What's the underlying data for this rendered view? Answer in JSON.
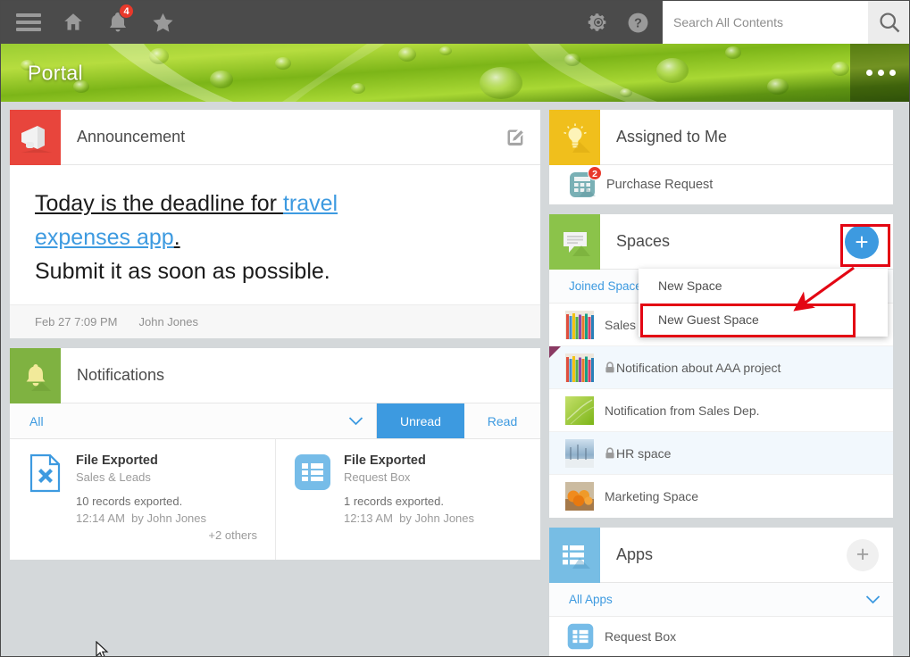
{
  "topbar": {
    "menu_icon": "hamburger-icon",
    "home_icon": "home-icon",
    "bell_icon": "bell-icon",
    "bell_badge": "4",
    "star_icon": "star-icon",
    "gear_icon": "gear-icon",
    "help_icon": "help-icon",
    "search_placeholder": "Search All Contents",
    "search_value": "",
    "search_icon": "magnifier-icon"
  },
  "banner": {
    "title": "Portal",
    "more_icon": "ellipsis-icon"
  },
  "announcement": {
    "icon": "megaphone-icon",
    "title": "Announcement",
    "edit_icon": "edit-pencil-icon",
    "line1_a": "Today is the deadline for ",
    "line1_link": "travel",
    "line2_link": "expenses app",
    "line2_period": ".",
    "line3": "Submit it as soon as possible.",
    "date": "Feb 27 7:09 PM",
    "author": "John Jones",
    "accent": "#e8453c"
  },
  "notifications": {
    "icon": "bell-icon",
    "title": "Notifications",
    "filter_all": "All",
    "filter_chevron": "chevron-down-icon",
    "tab_unread": "Unread",
    "tab_read": "Read",
    "accent": "#3d9ae0",
    "header_color": "#7fb241",
    "items": [
      {
        "icon": "file-export-icon",
        "title": "File Exported",
        "source": "Sales & Leads",
        "message": "10 records exported.",
        "time": "12:14 AM",
        "by": "by John Jones",
        "more": "+2 others"
      },
      {
        "icon": "list-app-icon",
        "title": "File Exported",
        "source": "Request Box",
        "message": "1 records exported.",
        "time": "12:13 AM",
        "by": "by John Jones",
        "more": ""
      }
    ]
  },
  "assigned": {
    "icon": "lightbulb-icon",
    "title": "Assigned to Me",
    "header_color": "#f0bf1c",
    "items": [
      {
        "icon": "calculator-icon",
        "label": "Purchase Request",
        "badge": "2"
      }
    ]
  },
  "spaces": {
    "icon": "speech-bubble-icon",
    "title": "Spaces",
    "header_color": "#8bc34a",
    "add_icon": "plus-circle-icon",
    "filter": "Joined Spaces",
    "filter_chevron": "chevron-down-icon",
    "items": [
      {
        "thumb": "pencils",
        "name": "Sales",
        "locked": false,
        "alt": false,
        "marked": false
      },
      {
        "thumb": "pencils",
        "name": "Notification about AAA project",
        "locked": true,
        "alt": true,
        "marked": true
      },
      {
        "thumb": "greenleaf",
        "name": "Notification from Sales Dep.",
        "locked": false,
        "alt": false,
        "marked": false
      },
      {
        "thumb": "winter",
        "name": "HR space",
        "locked": true,
        "alt": true,
        "marked": false
      },
      {
        "thumb": "oranges",
        "name": "Marketing Space",
        "locked": false,
        "alt": false,
        "marked": false
      }
    ]
  },
  "spaces_menu": {
    "items": [
      "New Space",
      "New Guest Space"
    ],
    "highlighted": "New Guest Space"
  },
  "apps": {
    "icon": "list-app-icon",
    "title": "Apps",
    "header_color": "#77bde4",
    "add_icon": "plus-icon",
    "filter": "All Apps",
    "filter_chevron": "chevron-down-icon",
    "items": [
      {
        "icon": "list-app-icon",
        "name": "Request Box"
      }
    ]
  },
  "annotations": {
    "color": "#e30613",
    "box_add_button": "highlight-add-space-button",
    "box_menu_item": "highlight-new-guest-space",
    "arrow": "arrow-pointing-from-add-button-to-menu-item"
  }
}
